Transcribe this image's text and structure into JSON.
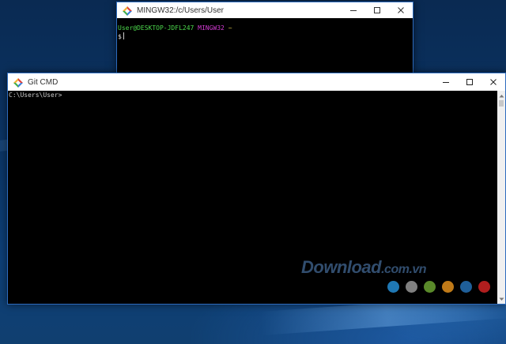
{
  "windows": {
    "mingw": {
      "title": "MINGW32:/c/Users/User",
      "prompt_user": "User@DESKTOP-JDFL247",
      "prompt_env": "MINGW32",
      "prompt_path": "~",
      "prompt_symbol": "$"
    },
    "cmd": {
      "title": "Git CMD",
      "prompt": "C:\\Users\\User>"
    }
  },
  "controls": {
    "minimize_icon": "minimize-icon",
    "maximize_icon": "maximize-icon",
    "close_icon": "close-icon"
  },
  "watermark": {
    "brand": "Download",
    "suffix": ".com.vn",
    "dot_colors": [
      "#1f78b4",
      "#808080",
      "#5a8a2a",
      "#c07a18",
      "#1f5f99",
      "#b01e1e"
    ]
  },
  "colors": {
    "accent_border": "#2d6cbf",
    "terminal_bg": "#000000",
    "prompt_green": "#4cd84c",
    "prompt_magenta": "#d43bd4"
  }
}
